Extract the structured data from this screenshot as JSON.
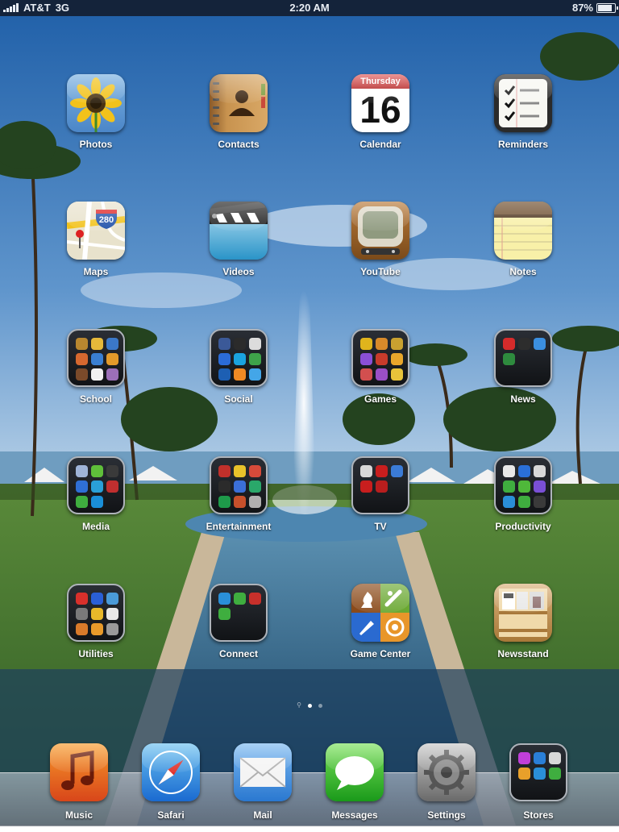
{
  "status_bar": {
    "carrier": "AT&T",
    "network": "3G",
    "time": "2:20 AM",
    "battery_text": "87%",
    "battery_level": 0.87
  },
  "apps": {
    "photos": "Photos",
    "contacts": "Contacts",
    "calendar": "Calendar",
    "calendar_weekday": "Thursday",
    "calendar_day": "16",
    "reminders": "Reminders",
    "maps": "Maps",
    "maps_shield": "280",
    "videos": "Videos",
    "youtube": "YouTube",
    "notes": "Notes",
    "school": "School",
    "social": "Social",
    "games": "Games",
    "news": "News",
    "media": "Media",
    "entertainment": "Entertainment",
    "tv": "TV",
    "productivity": "Productivity",
    "utilities": "Utilities",
    "connect": "Connect",
    "game_center": "Game Center",
    "newsstand": "Newsstand"
  },
  "dock": {
    "music": "Music",
    "safari": "Safari",
    "mail": "Mail",
    "messages": "Messages",
    "settings": "Settings",
    "stores": "Stores"
  },
  "page_indicator": {
    "pages": 2,
    "current": 1
  },
  "folder_mini_colors": {
    "school": [
      "#b8872f",
      "#e6b93a",
      "#3b78c8",
      "#d6682f",
      "#3a7fd1",
      "#e39a2a",
      "#7a4a2a",
      "#f1f1f1",
      "#9c6fb8"
    ],
    "social": [
      "#3b5998",
      "#2b2b2b",
      "#dcdcdc",
      "#2b6cd8",
      "#1aa3e0",
      "#3ea34a",
      "#1d5fb3",
      "#f08a24",
      "#43a6e8"
    ],
    "games": [
      "#e0b41c",
      "#d88a2a",
      "#c9a130",
      "#8a4fd6",
      "#c73b2b",
      "#e9a62b",
      "#d24f4f",
      "#9b4fc7",
      "#e8c33a"
    ],
    "news": [
      "#d62b2b",
      "#2d2d2d",
      "#3b8fe0",
      "#2e8b3e"
    ],
    "media": [
      "#9fb4d8",
      "#5fbf3a",
      "#3a3a3a",
      "#2f6fd6",
      "#2aa0d8",
      "#c02f2f",
      "#3fae3f",
      "#1a8fd8"
    ],
    "entertainment": [
      "#c0302b",
      "#e8c22a",
      "#d64a3a",
      "#2b2b2b",
      "#3b6fd8",
      "#2aa86a",
      "#1e9a4a",
      "#c7502b",
      "#b0b0b0"
    ],
    "tv": [
      "#d8d8d8",
      "#c81e1e",
      "#3b7bd6",
      "#c81e1e",
      "#b81e1e"
    ],
    "productivity": [
      "#e8e8e8",
      "#2a6fd8",
      "#d8d8d8",
      "#3fae3f",
      "#4fb83a",
      "#7a4fd6",
      "#2a8fd8",
      "#3fae3f",
      "#3a3a3a"
    ],
    "utilities": [
      "#d8302b",
      "#2a5fd6",
      "#4a9ad8",
      "#7a7a7a",
      "#e8b82a",
      "#e8e8e8",
      "#d87a2a",
      "#e89a2a",
      "#9a9a9a"
    ],
    "connect": [
      "#2a8fd8",
      "#3fae3f",
      "#c8302b",
      "#3fae3f"
    ],
    "stores": [
      "#c03fd8",
      "#2a7fd8",
      "#d8d8d8",
      "#e8a02a",
      "#2a8fd8",
      "#3fae3f"
    ]
  }
}
